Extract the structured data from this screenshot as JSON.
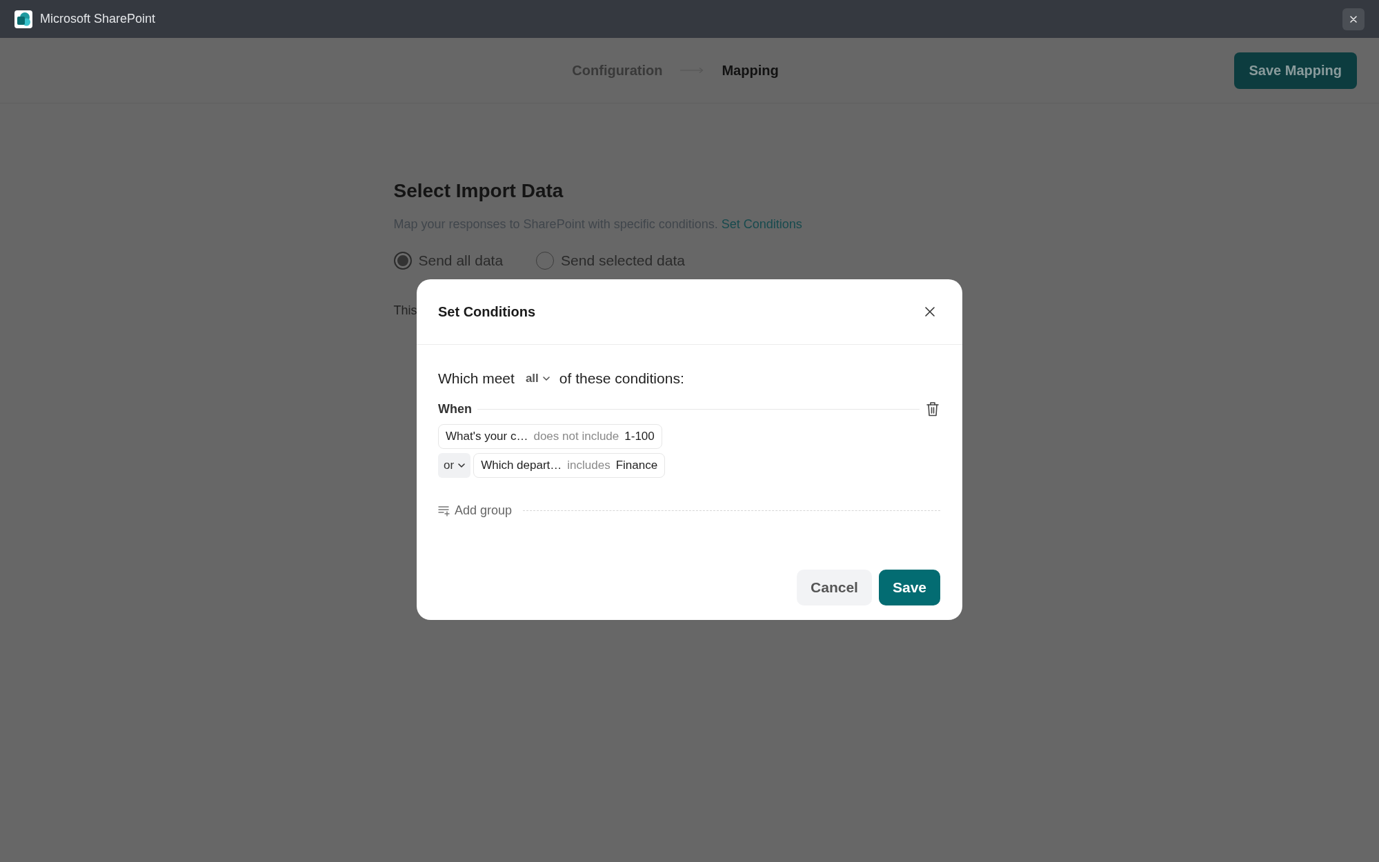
{
  "window": {
    "title": "Microsoft SharePoint"
  },
  "stepper": {
    "steps": [
      {
        "label": "Configuration",
        "selected": false
      },
      {
        "label": "Mapping",
        "selected": true
      }
    ]
  },
  "header": {
    "action_button": "Save Mapping"
  },
  "section": {
    "title": "Select Import Data",
    "description": "Map your responses to SharePoint with specific conditions.",
    "link": "Set Conditions",
    "options": [
      {
        "label": "Send all data",
        "selected": true
      },
      {
        "label": "Send selected data",
        "selected": false
      }
    ],
    "note": "This"
  },
  "dialog": {
    "title": "Set Conditions",
    "match": {
      "prefix": "Which meet",
      "mode": "all",
      "suffix": "of these conditions:"
    },
    "group": {
      "label": "When",
      "conditions": [
        {
          "field": "What's your c…",
          "operator": "does not include",
          "value": "1-100"
        },
        {
          "connector": "or",
          "field": "Which depart…",
          "operator": "includes",
          "value": "Finance"
        }
      ]
    },
    "add_group": "Add group",
    "buttons": [
      {
        "label": "Cancel",
        "kind": "secondary"
      },
      {
        "label": "Save",
        "kind": "primary"
      }
    ]
  }
}
